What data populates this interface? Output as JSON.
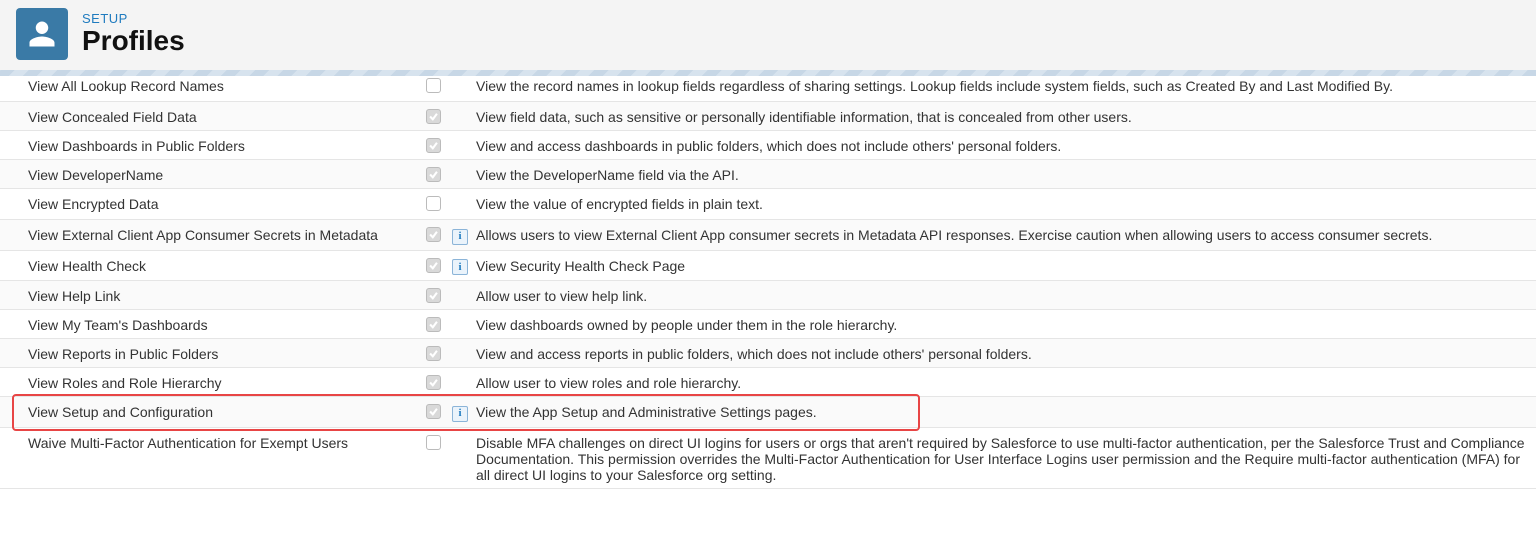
{
  "header": {
    "breadcrumb": "SETUP",
    "title": "Profiles"
  },
  "info_glyph": "i",
  "permissions": [
    {
      "label": "View All Lookup Record Names",
      "checked": false,
      "info": false,
      "desc": "View the record names in lookup fields regardless of sharing settings. Lookup fields include system fields, such as Created By and Last Modified By."
    },
    {
      "label": "View Concealed Field Data",
      "checked": true,
      "info": false,
      "desc": "View field data, such as sensitive or personally identifiable information, that is concealed from other users."
    },
    {
      "label": "View Dashboards in Public Folders",
      "checked": true,
      "info": false,
      "desc": "View and access dashboards in public folders, which does not include others' personal folders."
    },
    {
      "label": "View DeveloperName",
      "checked": true,
      "info": false,
      "desc": "View the DeveloperName field via the API."
    },
    {
      "label": "View Encrypted Data",
      "checked": false,
      "info": false,
      "desc": "View the value of encrypted fields in plain text."
    },
    {
      "label": "View External Client App Consumer Secrets in Metadata",
      "checked": true,
      "info": true,
      "desc": "Allows users to view External Client App consumer secrets in Metadata API responses. Exercise caution when allowing users to access consumer secrets."
    },
    {
      "label": "View Health Check",
      "checked": true,
      "info": true,
      "desc": "View Security Health Check Page"
    },
    {
      "label": "View Help Link",
      "checked": true,
      "info": false,
      "desc": "Allow user to view help link."
    },
    {
      "label": "View My Team's Dashboards",
      "checked": true,
      "info": false,
      "desc": "View dashboards owned by people under them in the role hierarchy."
    },
    {
      "label": "View Reports in Public Folders",
      "checked": true,
      "info": false,
      "desc": "View and access reports in public folders, which does not include others' personal folders."
    },
    {
      "label": "View Roles and Role Hierarchy",
      "checked": true,
      "info": false,
      "desc": "Allow user to view roles and role hierarchy."
    },
    {
      "label": "View Setup and Configuration",
      "checked": true,
      "info": true,
      "desc": "View the App Setup and Administrative Settings pages."
    },
    {
      "label": "Waive Multi-Factor Authentication for Exempt Users",
      "checked": false,
      "info": false,
      "desc": "Disable MFA challenges on direct UI logins for users or orgs that aren't required by Salesforce to use multi-factor authentication, per the Salesforce Trust and Compliance Documentation. This permission overrides the Multi-Factor Authentication for User Interface Logins user permission and the Require multi-factor authentication (MFA) for all direct UI logins to your Salesforce org setting."
    }
  ],
  "highlight": {
    "row_index": 11
  }
}
